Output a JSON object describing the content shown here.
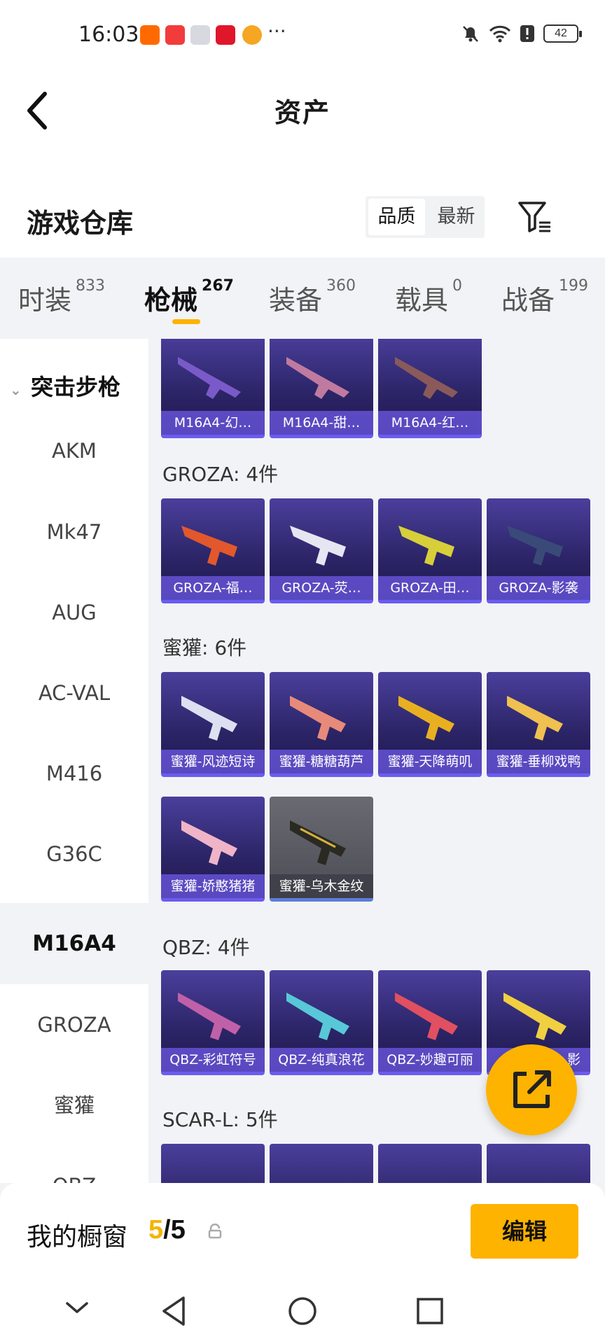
{
  "status_bar": {
    "time": "16:03",
    "battery": "42"
  },
  "nav": {
    "title": "资产"
  },
  "warehouse": {
    "title": "游戏仓库",
    "sort_options": [
      "品质",
      "最新"
    ],
    "selected_sort": "品质"
  },
  "tabs": [
    {
      "label": "时装",
      "count": "833"
    },
    {
      "label": "枪械",
      "count": "267"
    },
    {
      "label": "装备",
      "count": "360"
    },
    {
      "label": "载具",
      "count": "0"
    },
    {
      "label": "战备",
      "count": "199"
    }
  ],
  "active_tab": "枪械",
  "sidebar": {
    "group": "突击步枪",
    "items": [
      "AKM",
      "Mk47",
      "AUG",
      "AC-VAL",
      "M416",
      "G36C",
      "M16A4",
      "GROZA",
      "蜜獾",
      "QBZ"
    ],
    "selected": "M16A4"
  },
  "sections": [
    {
      "title": "",
      "items": [
        "M16A4-幻…",
        "M16A4-甜…",
        "M16A4-红…"
      ]
    },
    {
      "title": "GROZA: 4件",
      "items": [
        "GROZA-福…",
        "GROZA-荧…",
        "GROZA-田…",
        "GROZA-影袭"
      ]
    },
    {
      "title": "蜜獾: 6件",
      "items": [
        "蜜獾-风迹短诗",
        "蜜獾-糖糖葫芦",
        "蜜獾-天降萌叽",
        "蜜獾-垂柳戏鸭",
        "蜜獾-娇憨猪猪",
        "蜜獾-乌木金纹"
      ]
    },
    {
      "title": "QBZ: 4件",
      "items": [
        "QBZ-彩虹符号",
        "QBZ-纯真浪花",
        "QBZ-妙趣可丽",
        "影"
      ]
    },
    {
      "title": "SCAR-L: 5件",
      "items": [
        "",
        "",
        "",
        ""
      ]
    }
  ],
  "showcase": {
    "label": "我的橱窗",
    "current": "5",
    "sep_total": "/5",
    "edit_label": "编辑"
  },
  "colors": {
    "accent": "#fdb300",
    "card_purple": "#2b2466"
  }
}
